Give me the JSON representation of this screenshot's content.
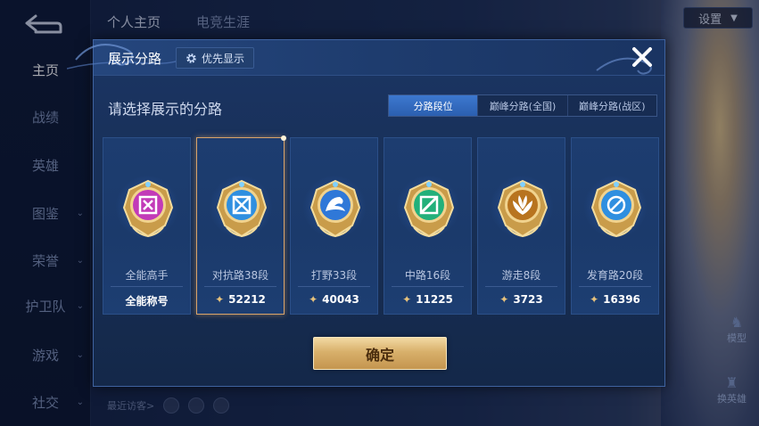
{
  "background": {
    "sidebar": [
      {
        "label": "主页",
        "active": true,
        "chevron": false
      },
      {
        "label": "战绩",
        "active": false,
        "chevron": false
      },
      {
        "label": "英雄",
        "active": false,
        "chevron": false
      },
      {
        "label": "图鉴",
        "active": false,
        "chevron": true
      },
      {
        "label": "荣誉",
        "active": false,
        "chevron": true
      },
      {
        "label": "护卫队",
        "active": false,
        "chevron": true
      },
      {
        "label": "游戏",
        "active": false,
        "chevron": true
      },
      {
        "label": "社交",
        "active": false,
        "chevron": true
      }
    ],
    "tabs": [
      "个人主页",
      "电竞生涯"
    ],
    "settings_label": "设置",
    "model_label": "模型",
    "swap_hero_label": "换英雄",
    "recent_visitors_label": "最近访客>"
  },
  "dialog": {
    "title": "展示分路",
    "priority_button": "优先显示",
    "subtitle": "请选择展示的分路",
    "segments": [
      {
        "label": "分路段位",
        "active": true
      },
      {
        "label": "巅峰分路(全国)",
        "active": false
      },
      {
        "label": "巅峰分路(战区)",
        "active": false
      }
    ],
    "cards": [
      {
        "label": "全能高手",
        "value": "全能称号",
        "icon": "all-round-badge-icon",
        "color": "#c23ab8",
        "selected": false,
        "show_value_icon": false
      },
      {
        "label": "对抗路38段",
        "value": "52212",
        "icon": "clash-lane-badge-icon",
        "color": "#2f8fe0",
        "selected": true,
        "show_value_icon": true
      },
      {
        "label": "打野33段",
        "value": "40043",
        "icon": "jungle-badge-icon",
        "color": "#2f78d8",
        "selected": false,
        "show_value_icon": true
      },
      {
        "label": "中路16段",
        "value": "11225",
        "icon": "mid-lane-badge-icon",
        "color": "#22b07a",
        "selected": false,
        "show_value_icon": true
      },
      {
        "label": "游走8段",
        "value": "3723",
        "icon": "roam-badge-icon",
        "color": "#b8741f",
        "selected": false,
        "show_value_icon": true
      },
      {
        "label": "发育路20段",
        "value": "16396",
        "icon": "farm-lane-badge-icon",
        "color": "#2f8fe0",
        "selected": false,
        "show_value_icon": true
      }
    ],
    "confirm_label": "确定"
  }
}
